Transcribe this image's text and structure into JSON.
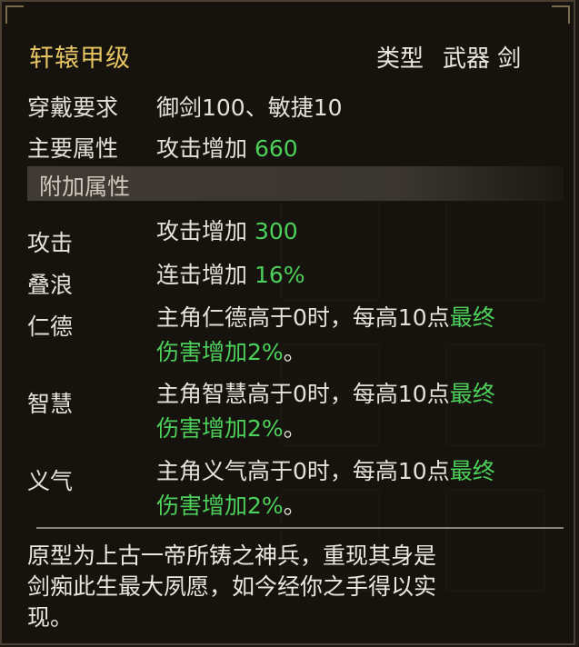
{
  "item": {
    "name": "轩辕甲级",
    "type_label": "类型",
    "type_value": "武器 剑"
  },
  "requirement": {
    "label": "穿戴要求",
    "value": "御剑100、敏捷10"
  },
  "main_attr": {
    "label": "主要属性",
    "text": "攻击增加",
    "value": "660"
  },
  "extra_section": {
    "title": "附加属性"
  },
  "extra_attrs": [
    {
      "name": "攻击",
      "text": "攻击增加",
      "value": "300"
    },
    {
      "name": "叠浪",
      "text": "连击增加",
      "value": "16%"
    },
    {
      "name": "仁德",
      "line1_text": "主角仁德高于0时，每高10点",
      "line1_green": "最终",
      "line2_green": "伤害增加2%",
      "line2_tail": "。"
    },
    {
      "name": "智慧",
      "line1_text": "主角智慧高于0时，每高10点",
      "line1_green": "最终",
      "line2_green": "伤害增加2%",
      "line2_tail": "。"
    },
    {
      "name": "义气",
      "line1_text": "主角义气高于0时，每高10点",
      "line1_green": "最终",
      "line2_green": "伤害增加2%",
      "line2_tail": "。"
    }
  ],
  "description": {
    "line1": "原型为上古一帝所铸之神兵，重现其身是",
    "line2": "剑痴此生最大夙愿，如今经你之手得以实",
    "line3": "现。"
  },
  "colors": {
    "title": "#e4c463",
    "green": "#4cd05a",
    "background": "#16120e"
  }
}
